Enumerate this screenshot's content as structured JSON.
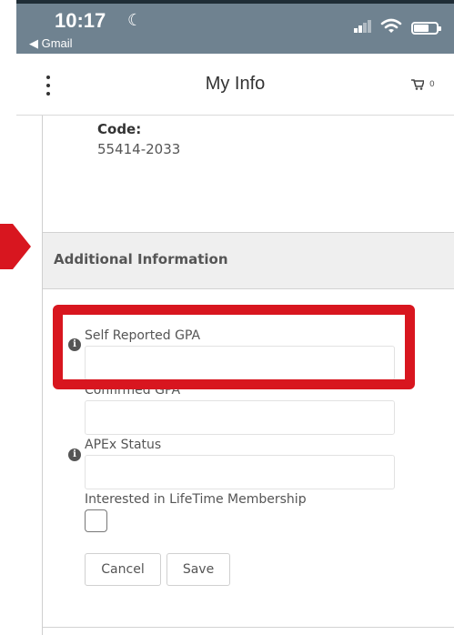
{
  "status_bar": {
    "time": "10:17",
    "back_app": "◀ Gmail"
  },
  "header": {
    "title": "My Info",
    "cart_count": "0",
    "menu_icon": "kebab-icon",
    "cart_icon": "cart-icon"
  },
  "address": {
    "code_label": "Code:",
    "code_value": "55414-2033"
  },
  "section": {
    "title": "Additional Information"
  },
  "form": {
    "gpa_label": "Self Reported GPA",
    "gpa_value": "",
    "confirmed_gpa_label": "Confirmed GPA",
    "confirmed_gpa_value": "",
    "apex_label": "APEx Status",
    "apex_value": "",
    "membership_label": "Interested in LifeTime Membership",
    "membership_checked": false,
    "info_icon_glyph": "i"
  },
  "buttons": {
    "cancel": "Cancel",
    "save": "Save"
  },
  "colors": {
    "status_bar": "#6f8290",
    "highlight": "#d8161f",
    "section_bg": "#efefef"
  }
}
